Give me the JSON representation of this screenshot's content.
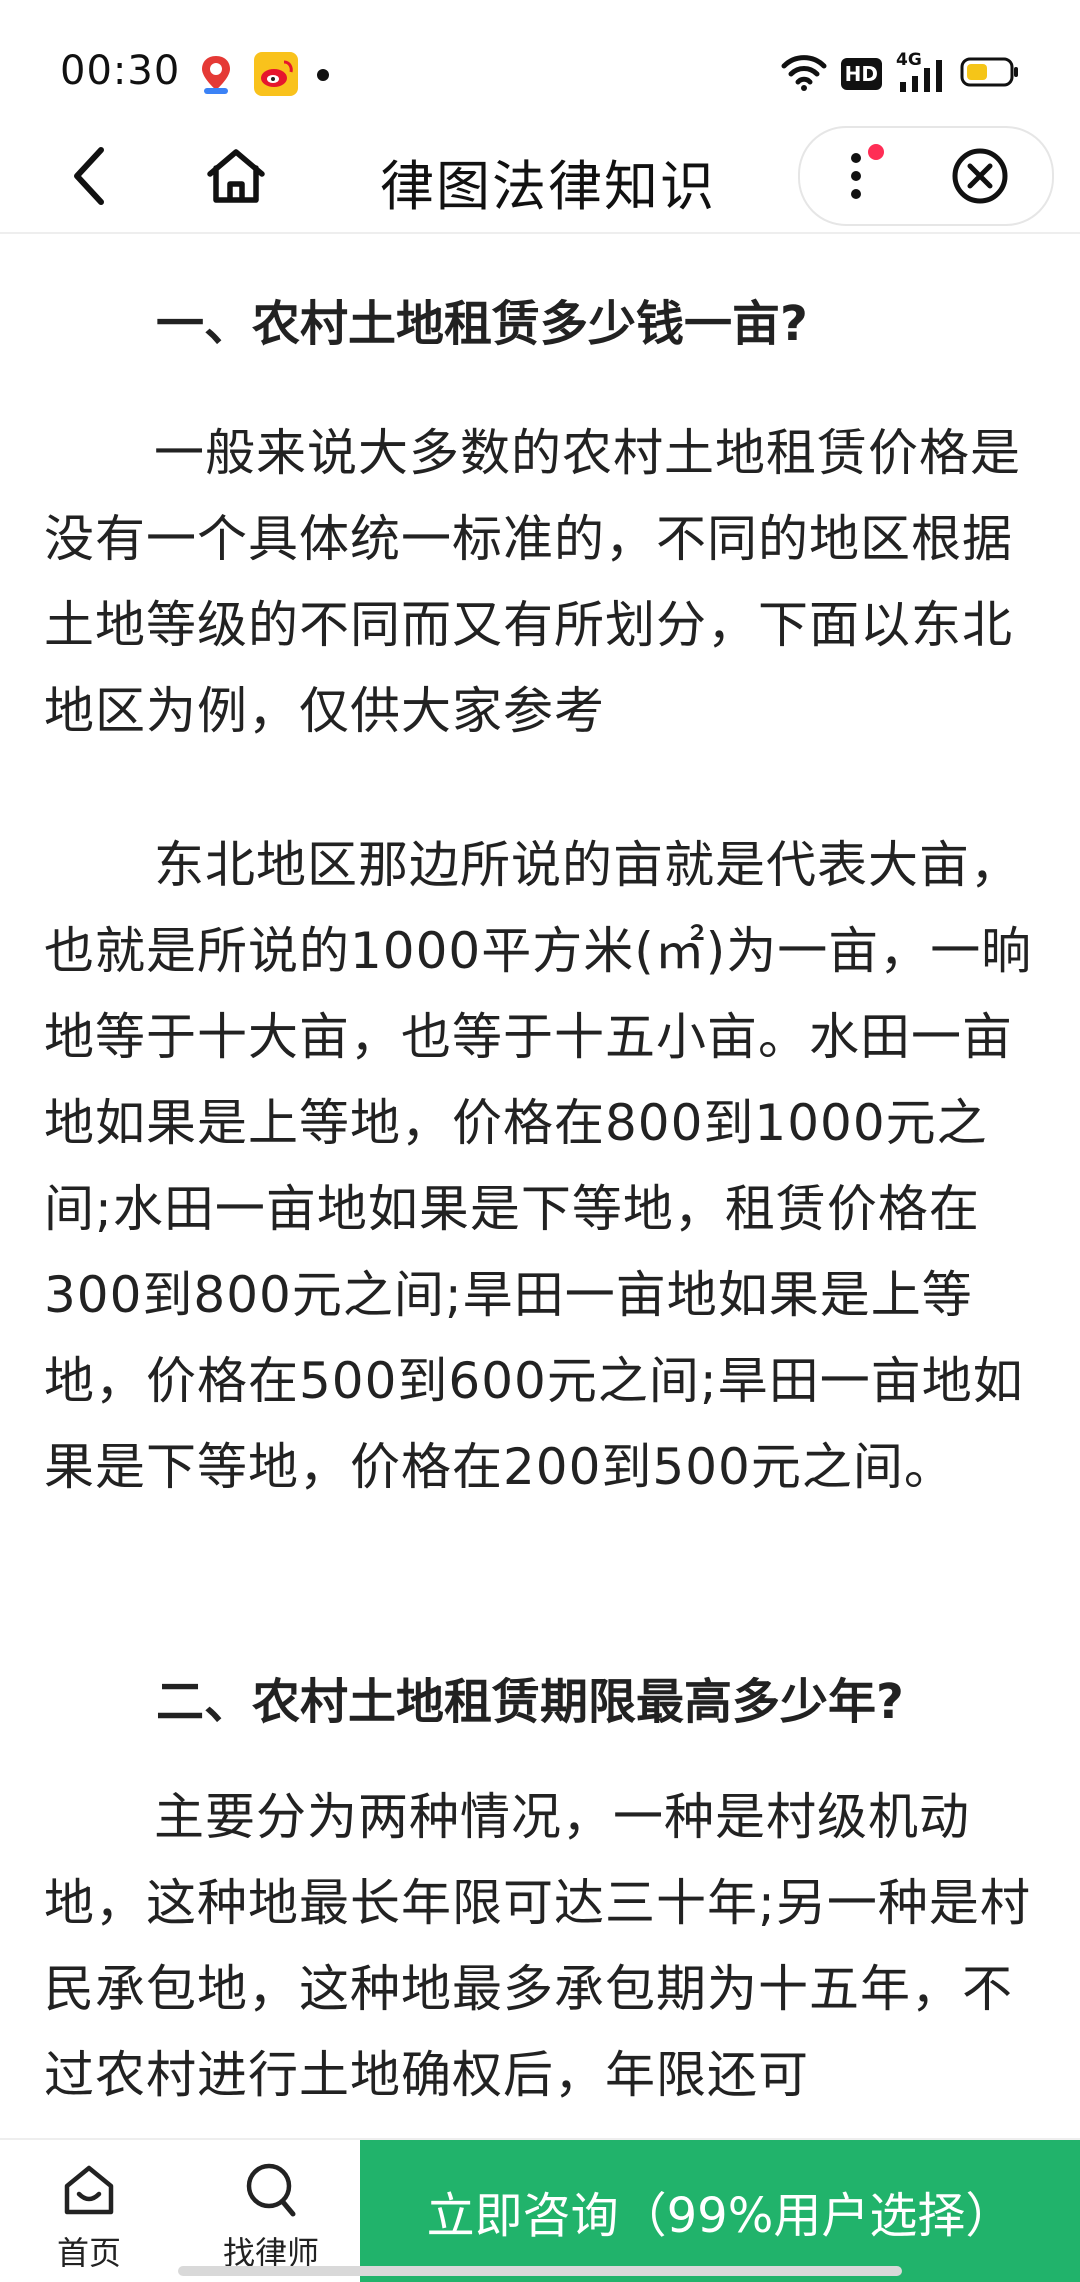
{
  "status_bar": {
    "time": "00:30",
    "icons_left": [
      "map-app-icon",
      "weibo-icon",
      "notification-dot-icon"
    ],
    "icons_right": [
      "wifi-icon",
      "hd-icon",
      "4g-signal-icon",
      "battery-icon"
    ],
    "hd_label": "HD",
    "network_label": "4G"
  },
  "nav": {
    "title": "律图法律知识"
  },
  "article": {
    "heading1": "一、农村土地租赁多少钱一亩?",
    "para1": "一般来说大多数的农村土地租赁价格是没有一个具体统一标准的，不同的地区根据土地等级的不同而又有所划分，下面以东北地区为例，仅供大家参考",
    "para2": "东北地区那边所说的亩就是代表大亩，也就是所说的1000平方米(㎡)为一亩，一晌地等于十大亩，也等于十五小亩。水田一亩地如果是上等地，价格在800到1000元之间;水田一亩地如果是下等地，租赁价格在300到800元之间;旱田一亩地如果是上等地，价格在500到600元之间;旱田一亩地如果是下等地，价格在200到500元之间。",
    "heading2": "二、农村土地租赁期限最高多少年?",
    "para3": "主要分为两种情况，一种是村级机动地，这种地最长年限可达三十年;另一种是村民承包地，这种地最多承包期为十五年，不过农村进行土地确权后，年限还可"
  },
  "bottom_bar": {
    "home_label": "首页",
    "find_lawyer_label": "找律师",
    "consult_label": "立即咨询（99%用户选择）"
  },
  "colors": {
    "accent_green": "#21b36b",
    "notification_red": "#ff2d55",
    "battery_yellow": "#f5c518"
  }
}
